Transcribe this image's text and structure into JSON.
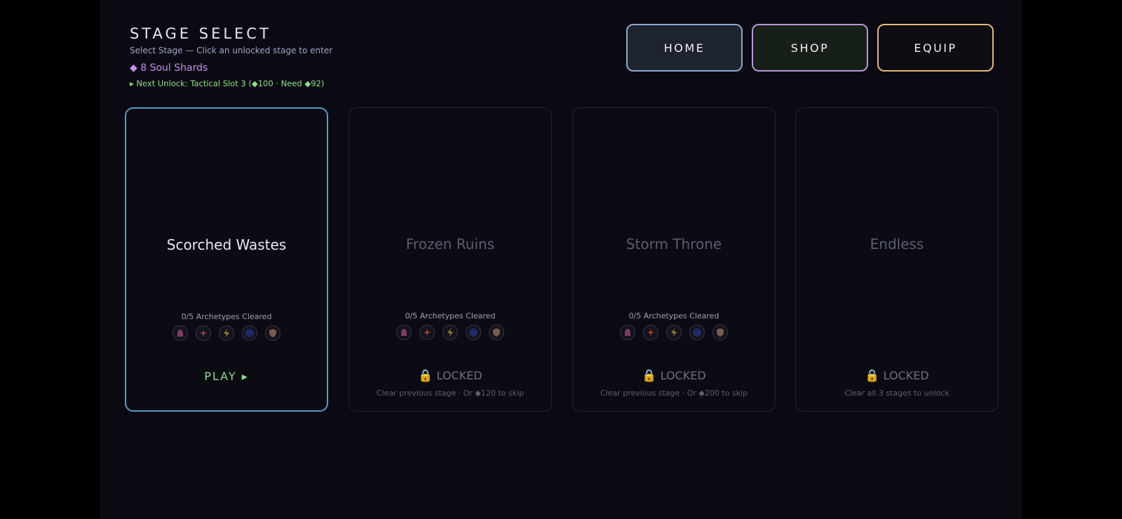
{
  "header": {
    "title": "STAGE SELECT",
    "subtitle": "Select Stage — Click an unlocked stage to enter",
    "shards": "◆ 8 Soul Shards",
    "next_unlock": "▸ Next Unlock: Tactical Slot 3 (◆100 · Need ◆92)"
  },
  "nav": {
    "home_label": "HOME",
    "shop_label": "SHOP",
    "equip_label": "EQUIP"
  },
  "archetype_icons": [
    "hood-icon",
    "burst-icon",
    "lightning-icon",
    "orb-icon",
    "shield-icon"
  ],
  "cards": [
    {
      "name": "Scorched Wastes",
      "progress": "0/5 Archetypes Cleared",
      "action": "PLAY ▸",
      "status": "unlocked"
    },
    {
      "name": "Frozen Ruins",
      "progress": "0/5 Archetypes Cleared",
      "action": "LOCKED",
      "sub": "Clear previous stage · Or ◆120 to skip",
      "status": "locked"
    },
    {
      "name": "Storm Throne",
      "progress": "0/5 Archetypes Cleared",
      "action": "LOCKED",
      "sub": "Clear previous stage · Or ◆200 to skip",
      "status": "locked"
    },
    {
      "name": "Endless",
      "action": "LOCKED",
      "sub": "Clear all 3 stages to unlock",
      "status": "locked"
    }
  ],
  "colors": {
    "active_border": "#4fa0c6",
    "play": "#86e08c",
    "shards": "#c58cf2",
    "next_unlock": "#8ee08a"
  }
}
